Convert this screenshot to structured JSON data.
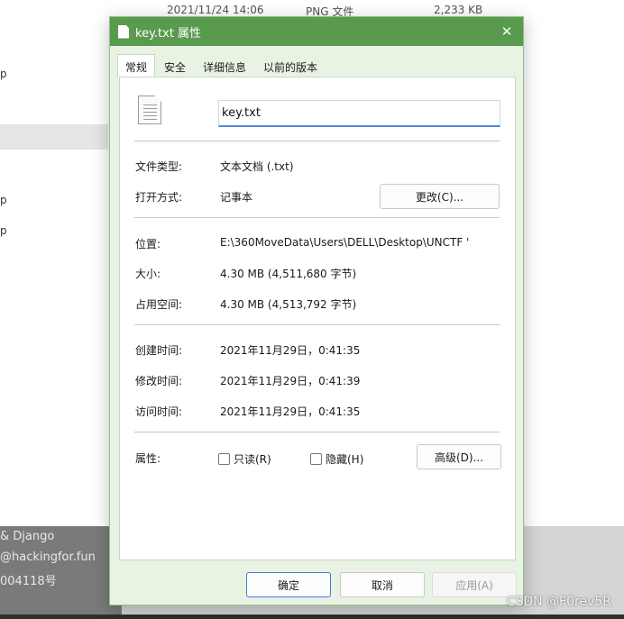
{
  "background": {
    "file_row": {
      "date": "2021/11/24 14:06",
      "type": "PNG 文件",
      "size": "2,233 KB"
    },
    "left_fragments": [
      "p",
      "p",
      "p"
    ],
    "footer_lines": [
      "& Django",
      "@hackingfor.fun",
      "004118号"
    ],
    "watermark": "CSDN @F0rev5R"
  },
  "dialog": {
    "title": "key.txt 属性",
    "tabs": [
      "常规",
      "安全",
      "详细信息",
      "以前的版本"
    ],
    "filename": "key.txt",
    "fields": {
      "file_type_label": "文件类型:",
      "file_type_value": "文本文档 (.txt)",
      "opens_with_label": "打开方式:",
      "opens_with_value": "记事本",
      "change_button": "更改(C)...",
      "location_label": "位置:",
      "location_value": "E:\\360MoveData\\Users\\DELL\\Desktop\\UNCTF '",
      "size_label": "大小:",
      "size_value": "4.30 MB (4,511,680 字节)",
      "size_on_disk_label": "占用空间:",
      "size_on_disk_value": "4.30 MB (4,513,792 字节)",
      "created_label": "创建时间:",
      "created_value": "2021年11月29日，0:41:35",
      "modified_label": "修改时间:",
      "modified_value": "2021年11月29日，0:41:39",
      "accessed_label": "访问时间:",
      "accessed_value": "2021年11月29日，0:41:35",
      "attributes_label": "属性:",
      "readonly_label": "只读(R)",
      "hidden_label": "隐藏(H)",
      "advanced_button": "高级(D)..."
    },
    "footer": {
      "ok": "确定",
      "cancel": "取消",
      "apply": "应用(A)"
    },
    "colors": {
      "titlebar": "#5a9a4e",
      "dialog_bg": "#e9f3e4",
      "input_underline": "#4a8bd6"
    }
  }
}
